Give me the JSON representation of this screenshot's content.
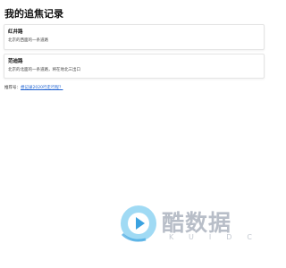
{
  "page": {
    "title": "我的追焦记录"
  },
  "records": [
    {
      "title": "红井路",
      "description": "北京的西面的一条道路"
    },
    {
      "title": "范迪路",
      "description": "北京的北面的一条道路，将在地北三出口"
    }
  ],
  "related": {
    "label": "推荐号：",
    "link_text": "想记录2020行走行程？"
  },
  "watermark": {
    "text": "酷数据",
    "subtext": "KUIDC",
    "colors": {
      "logo_blue": "#7ecdf0",
      "logo_deep": "#3ba2e0",
      "text_gray": "#b8bec8"
    }
  }
}
